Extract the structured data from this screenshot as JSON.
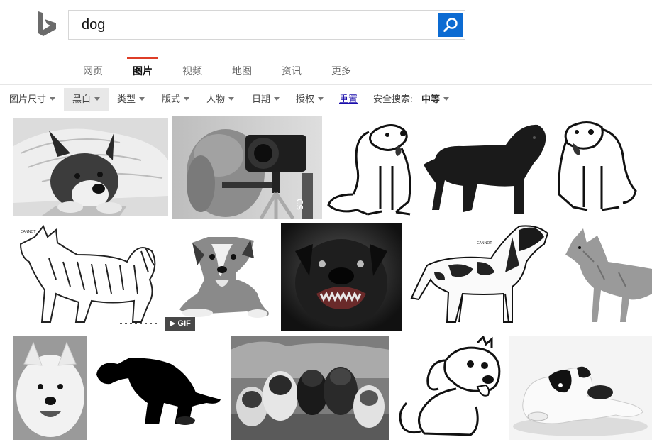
{
  "search": {
    "query": "dog"
  },
  "tabs": [
    {
      "label": "网页"
    },
    {
      "label": "图片"
    },
    {
      "label": "视频"
    },
    {
      "label": "地图"
    },
    {
      "label": "资讯"
    },
    {
      "label": "更多"
    }
  ],
  "active_tab": "图片",
  "filters": {
    "size": "图片尺寸",
    "color": "黑白",
    "type": "类型",
    "layout": "版式",
    "people": "人物",
    "date": "日期",
    "license": "授权",
    "reset": "重置",
    "safe_label": "安全搜索:",
    "safe_value": "中等"
  },
  "results": {
    "gif_badge": "GIF",
    "images": [
      {
        "subject": "husky under blanket"
      },
      {
        "subject": "golden retriever with camera"
      },
      {
        "subject": "puppy line drawing"
      },
      {
        "subject": "black mastiff"
      },
      {
        "subject": "puppy line drawing"
      },
      {
        "subject": "samoyed sketch"
      },
      {
        "subject": "border collie lying"
      },
      {
        "subject": "snarling rottweiler"
      },
      {
        "subject": "springer spaniel sketch"
      },
      {
        "subject": "dingo drawing"
      },
      {
        "subject": "samoyed portrait"
      },
      {
        "subject": "pooping dog silhouette"
      },
      {
        "subject": "puppies on log"
      },
      {
        "subject": "cartoon dog"
      },
      {
        "subject": "puppy lying"
      }
    ]
  },
  "colors": {
    "accent": "#de3e27",
    "search_button": "#0c6bd2",
    "link": "#1a0dab",
    "logo": "#6b6b6b"
  }
}
